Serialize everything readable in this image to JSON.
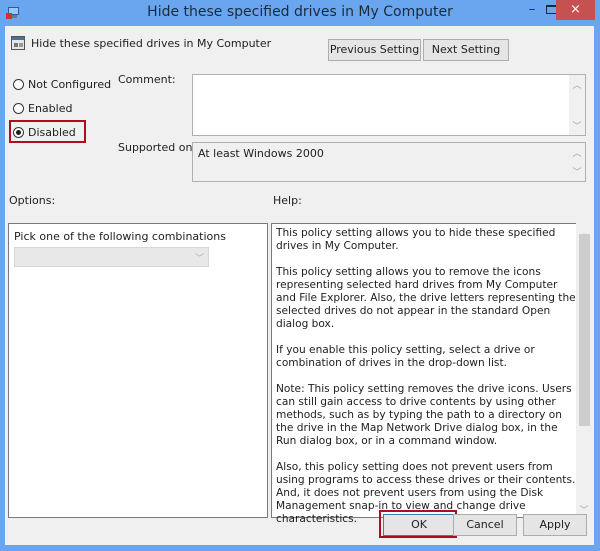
{
  "window": {
    "title": "Hide these specified drives in My Computer",
    "controls": {
      "minimize": "–",
      "close": "×"
    }
  },
  "header": {
    "policy_name": "Hide these specified drives in My Computer",
    "previous_label": "Previous Setting",
    "next_label": "Next Setting"
  },
  "state": {
    "options": [
      {
        "label": "Not Configured",
        "checked": false
      },
      {
        "label": "Enabled",
        "checked": false
      },
      {
        "label": "Disabled",
        "checked": true
      }
    ]
  },
  "comment": {
    "label": "Comment:",
    "value": ""
  },
  "supported": {
    "label": "Supported on:",
    "value": "At least Windows 2000"
  },
  "options_panel": {
    "label": "Options:",
    "combo_label": "Pick one of the following combinations",
    "combo_value": ""
  },
  "help_panel": {
    "label": "Help:",
    "paragraphs": [
      "This policy setting allows you to hide these specified drives in My Computer.",
      "This policy setting allows you to remove the icons representing selected hard drives from My Computer and File Explorer. Also, the drive letters representing the selected drives do not appear in the standard Open dialog box.",
      "If you enable this policy setting, select a drive or combination of drives in the drop-down list.",
      "Note: This policy setting removes the drive icons. Users can still gain access to drive contents by using other methods, such as by typing the path to a directory on the drive in the Map Network Drive dialog box, in the Run dialog box, or in a command window.",
      "Also, this policy setting does not prevent users from using programs to access these drives or their contents. And, it does not prevent users from using the Disk Management snap-in to view and change drive characteristics."
    ]
  },
  "footer": {
    "ok_label": "OK",
    "cancel_label": "Cancel",
    "apply_label": "Apply"
  },
  "colors": {
    "titlebar": "#6aa6ef",
    "close": "#c75050",
    "highlight": "#b00b1e"
  }
}
